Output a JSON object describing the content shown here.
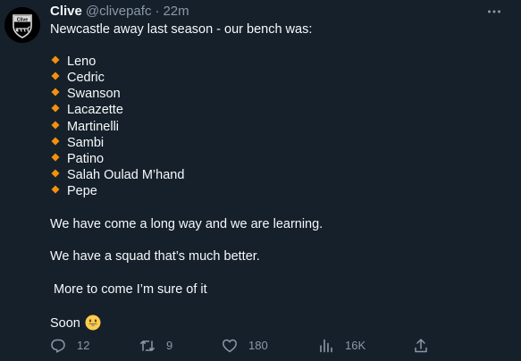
{
  "tweet": {
    "author": {
      "name": "Clive",
      "handle": "@clivepafc",
      "separator": "·",
      "time": "22m",
      "avatar_text": "Clive"
    },
    "more_icon": "more-horizontal-icon",
    "intro": "Newcastle away last season - our bench was:",
    "bench_list": [
      "Leno",
      "Cedric",
      "Swanson",
      "Lacazette",
      "Martinelli",
      "Sambi",
      "Patino",
      "Salah Oulad M’hand",
      "Pepe"
    ],
    "paragraphs": [
      "We have come a long way and we are learning.",
      "We have a squad that’s much better.",
      " More to come I’m sure of it"
    ],
    "closing": "Soon",
    "emoji": "grinning-face",
    "bullet_color": "#f4900c",
    "actions": {
      "reply": {
        "icon": "reply-icon",
        "count": "12"
      },
      "retweet": {
        "icon": "retweet-icon",
        "count": "9"
      },
      "like": {
        "icon": "heart-icon",
        "count": "180"
      },
      "views": {
        "icon": "analytics-icon",
        "count": "16K"
      },
      "share": {
        "icon": "share-icon"
      }
    }
  }
}
